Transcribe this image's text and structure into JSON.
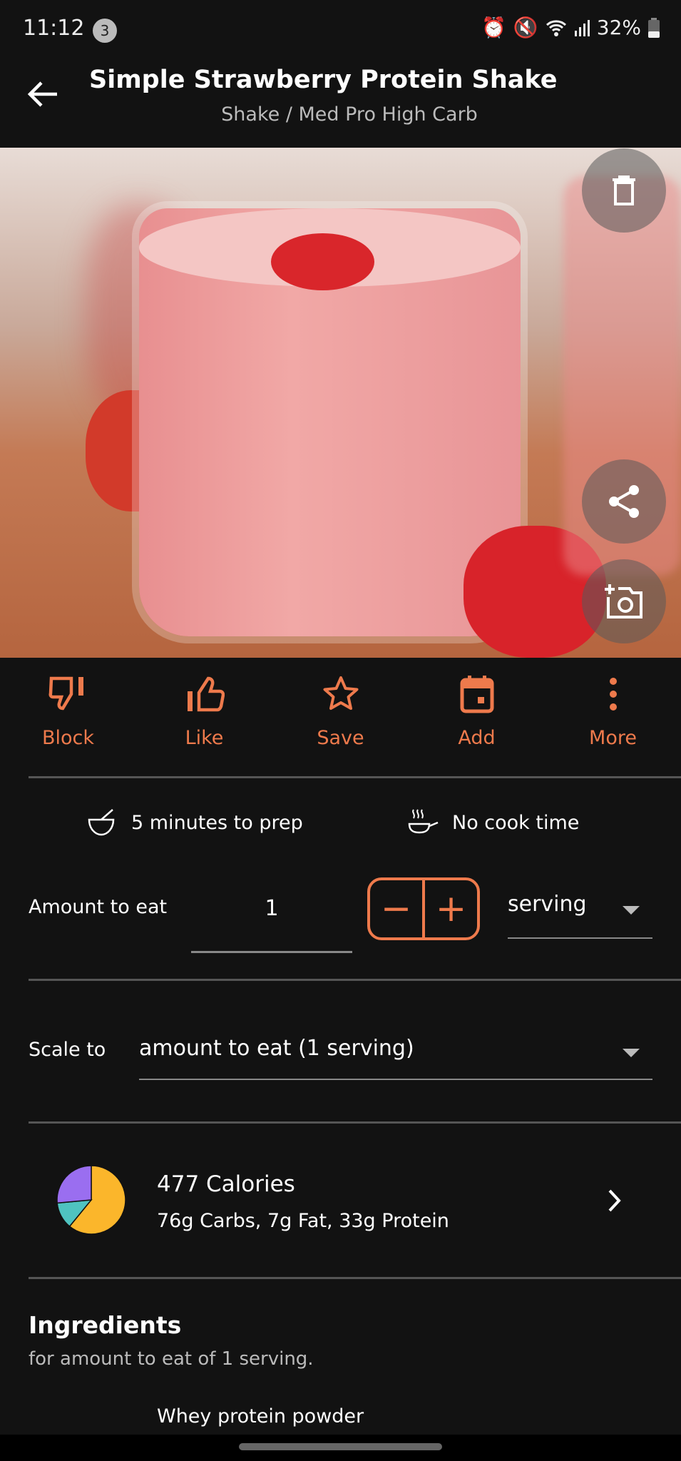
{
  "status_bar": {
    "time": "11:12",
    "notification_count": "3",
    "battery": "32%",
    "icons": [
      "alarm-icon",
      "mute-icon",
      "wifi-icon",
      "signal-icon",
      "battery-icon"
    ]
  },
  "header": {
    "title": "Simple Strawberry Protein Shake",
    "subtitle": "Shake / Med Pro High Carb"
  },
  "image_buttons": [
    "delete-icon",
    "share-icon",
    "add-photo-icon"
  ],
  "actions": [
    {
      "label": "Block",
      "icon": "thumbs-down-icon"
    },
    {
      "label": "Like",
      "icon": "thumbs-up-icon"
    },
    {
      "label": "Save",
      "icon": "star-icon"
    },
    {
      "label": "Add",
      "icon": "calendar-icon"
    },
    {
      "label": "More",
      "icon": "more-vert-icon"
    }
  ],
  "times": {
    "prep": "5 minutes to prep",
    "cook": "No cook time"
  },
  "amount": {
    "label": "Amount to eat",
    "value": "1",
    "minus": "−",
    "plus": "+",
    "unit": "serving"
  },
  "scale": {
    "label": "Scale to",
    "value": "amount to eat (1 serving)"
  },
  "nutrition": {
    "calories": "477 Calories",
    "macros": "76g Carbs, 7g Fat, 33g Protein"
  },
  "chart_data": {
    "type": "pie",
    "categories": [
      "Carbs",
      "Fat",
      "Protein"
    ],
    "values": [
      76,
      7,
      33
    ],
    "colors": [
      "#fbb62b",
      "#4fc3c0",
      "#9a6ef0"
    ]
  },
  "ingredients": {
    "title": "Ingredients",
    "subtitle": "for amount to eat of 1 serving.",
    "items": [
      "Whey protein powder"
    ]
  },
  "colors": {
    "accent": "#ee7a4c",
    "background": "#121212"
  }
}
